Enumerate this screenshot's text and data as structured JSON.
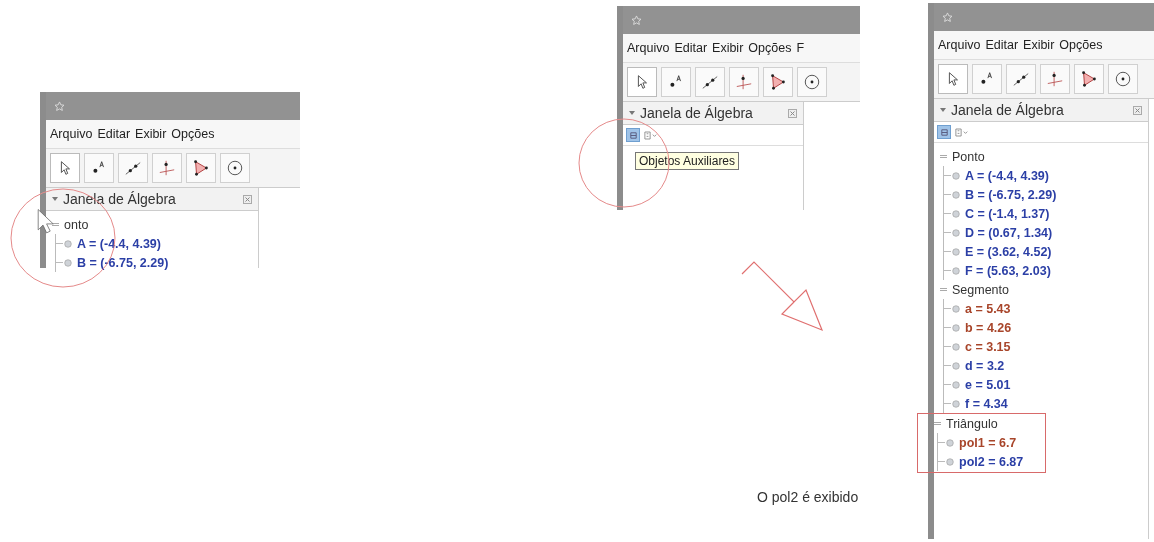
{
  "screenshots": [
    {
      "menu": [
        "Arquivo",
        "Editar",
        "Exibir",
        "Opções"
      ],
      "algebra_title": "Janela de Álgebra",
      "groups": [
        {
          "label": "onto",
          "items": [
            {
              "text": "A = (-4.4, 4.39)",
              "color": "#2b3fa6"
            },
            {
              "text": "B = (-6.75, 2.29)",
              "color": "#2b3fa6"
            }
          ]
        }
      ]
    },
    {
      "menu": [
        "Arquivo",
        "Editar",
        "Exibir",
        "Opções",
        "F"
      ],
      "algebra_title": "Janela de Álgebra",
      "style_bar": {
        "selected": true
      },
      "tooltip": "Objetos Auxiliares"
    },
    {
      "menu": [
        "Arquivo",
        "Editar",
        "Exibir",
        "Opções"
      ],
      "algebra_title": "Janela de Álgebra",
      "style_bar": {
        "selected": true
      },
      "groups": [
        {
          "label": "Ponto",
          "highlighted": false,
          "items": [
            {
              "text": "A = (-4.4, 4.39)",
              "color": "#2b3fa6"
            },
            {
              "text": "B = (-6.75, 2.29)",
              "color": "#2b3fa6"
            },
            {
              "text": "C = (-1.4, 1.37)",
              "color": "#2b3fa6"
            },
            {
              "text": "D = (0.67, 1.34)",
              "color": "#2b3fa6"
            },
            {
              "text": "E = (3.62, 4.52)",
              "color": "#2b3fa6"
            },
            {
              "text": "F = (5.63, 2.03)",
              "color": "#2b3fa6"
            }
          ]
        },
        {
          "label": "Segmento",
          "highlighted": false,
          "items": [
            {
              "text": "a = 5.43",
              "color": "#a8452a"
            },
            {
              "text": "b = 4.26",
              "color": "#a8452a"
            },
            {
              "text": "c = 3.15",
              "color": "#a8452a"
            },
            {
              "text": "d = 3.2",
              "color": "#2b3fa6"
            },
            {
              "text": "e = 5.01",
              "color": "#2b3fa6"
            },
            {
              "text": "f = 4.34",
              "color": "#2b3fa6"
            }
          ]
        },
        {
          "label": "Triângulo",
          "highlighted": true,
          "items": [
            {
              "text": "pol1 = 6.7",
              "color": "#a8452a"
            },
            {
              "text": "pol2 = 6.87",
              "color": "#2b3fa6"
            }
          ]
        }
      ]
    }
  ],
  "caption": "O pol2 é exibido"
}
